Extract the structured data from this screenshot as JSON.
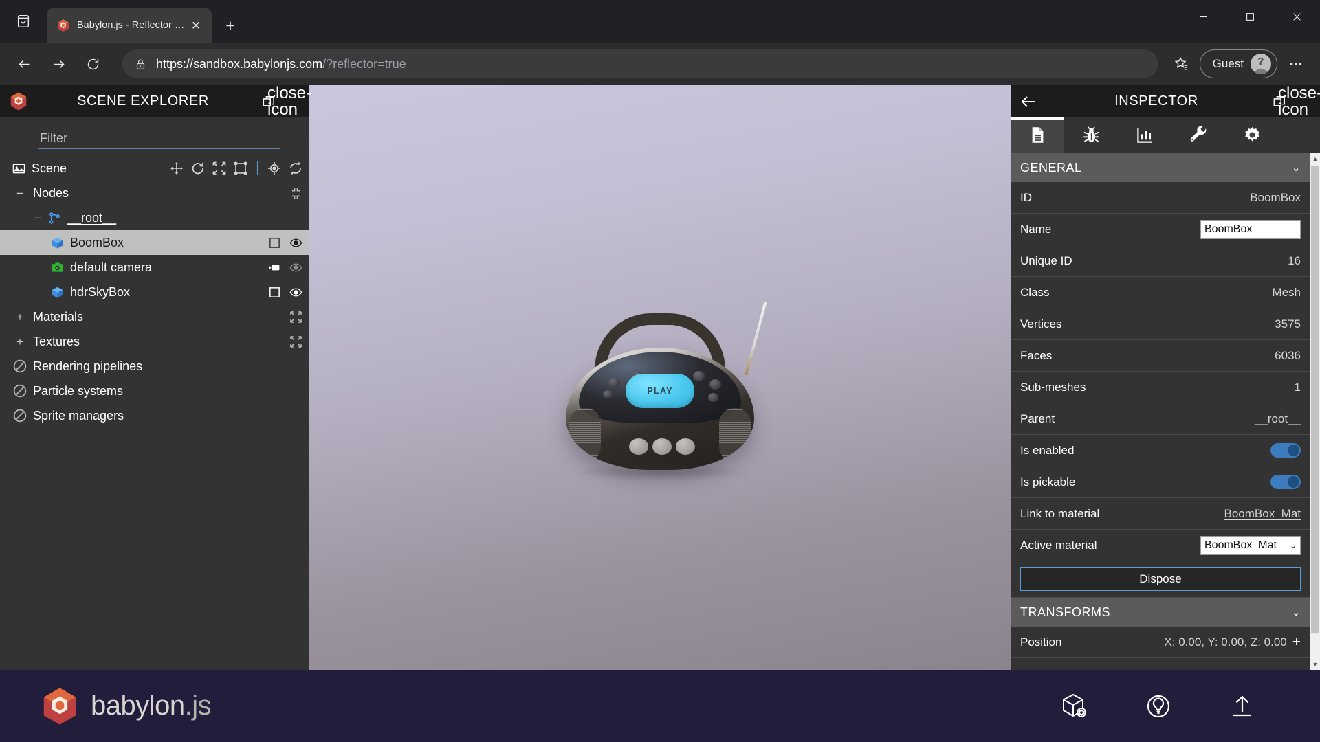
{
  "browser": {
    "tab": {
      "title": "Babylon.js - Reflector scene",
      "favicon": "babylon-logo-icon",
      "close": "✕"
    },
    "new_tab_label": "+",
    "tab_list_icon": "tab-list-icon",
    "nav": {
      "back": "back-arrow-icon",
      "forward": "forward-arrow-icon",
      "reload": "reload-icon"
    },
    "omnibox": {
      "lock": "lock-icon",
      "url_host": "https://sandbox.babylonjs.com",
      "url_path": "/?reflector=true",
      "full_url": "https://sandbox.babylonjs.com/?reflector=true"
    },
    "favorites_icon": "favorites-star-icon",
    "profile": {
      "name": "Guest",
      "avatar_badge": "?"
    },
    "settings_icon": "more-options-icon",
    "window": {
      "minimize": "minimize-icon",
      "maximize": "maximize-icon",
      "close": "close-icon"
    }
  },
  "scene_explorer": {
    "title": "SCENE EXPLORER",
    "logo": "babylon-hex-logo",
    "popout_icon": "popout-window-icon",
    "close_icon": "close-icon",
    "filter": {
      "placeholder": "Filter",
      "value": ""
    },
    "scene_row": {
      "label": "Scene",
      "icon": "scene-image-icon",
      "gizmos": [
        "move-gizmo-icon",
        "rotate-gizmo-icon",
        "scale-gizmo-icon",
        "bounding-box-gizmo-icon"
      ],
      "pivot_icon": "pivot-target-icon",
      "refresh_icon": "refresh-icon"
    },
    "tree": [
      {
        "label": "Nodes",
        "indent": 1,
        "expander": "−",
        "icon": "",
        "actions": [
          "collapse-all-icon"
        ],
        "selected": false
      },
      {
        "label": "__root__",
        "indent": 2,
        "expander": "−",
        "icon": "transform-node-icon",
        "actions": [],
        "selected": false,
        "underlined": true
      },
      {
        "label": "BoomBox",
        "indent": 3,
        "expander": "",
        "icon": "mesh-cube-icon",
        "actions": [
          "checkbox-icon",
          "eye-visible-icon"
        ],
        "selected": true
      },
      {
        "label": "default camera",
        "indent": 3,
        "expander": "",
        "icon": "camera-icon",
        "actions": [
          "video-camera-icon",
          "eye-dim-icon"
        ],
        "selected": false
      },
      {
        "label": "hdrSkyBox",
        "indent": 3,
        "expander": "",
        "icon": "mesh-cube-icon",
        "actions": [
          "checkbox-icon",
          "eye-visible-icon"
        ],
        "selected": false
      },
      {
        "label": "Materials",
        "indent": 1,
        "expander": "+",
        "icon": "",
        "actions": [
          "expand-arrows-icon"
        ],
        "selected": false
      },
      {
        "label": "Textures",
        "indent": 1,
        "expander": "+",
        "icon": "",
        "actions": [
          "expand-arrows-icon"
        ],
        "selected": false
      },
      {
        "label": "Rendering pipelines",
        "indent": 1,
        "expander": "∅",
        "icon": "",
        "actions": [],
        "selected": false
      },
      {
        "label": "Particle systems",
        "indent": 1,
        "expander": "∅",
        "icon": "",
        "actions": [],
        "selected": false
      },
      {
        "label": "Sprite managers",
        "indent": 1,
        "expander": "∅",
        "icon": "",
        "actions": [],
        "selected": false
      }
    ]
  },
  "inspector": {
    "title": "INSPECTOR",
    "back_icon": "back-arrow-icon",
    "popout_icon": "popout-window-icon",
    "close_icon": "close-icon",
    "tabs": [
      {
        "name": "properties",
        "icon": "document-icon",
        "active": true
      },
      {
        "name": "debug",
        "icon": "bug-icon",
        "active": false
      },
      {
        "name": "statistics",
        "icon": "bar-chart-icon",
        "active": false
      },
      {
        "name": "tools",
        "icon": "wrench-icon",
        "active": false
      },
      {
        "name": "settings",
        "icon": "gear-icon",
        "active": false
      }
    ],
    "sections": [
      {
        "title": "GENERAL",
        "collapse_chevron": "⌄",
        "rows": [
          {
            "label": "ID",
            "value": "BoomBox",
            "type": "text"
          },
          {
            "label": "Name",
            "value": "BoomBox",
            "type": "input"
          },
          {
            "label": "Unique ID",
            "value": "16",
            "type": "text"
          },
          {
            "label": "Class",
            "value": "Mesh",
            "type": "text"
          },
          {
            "label": "Vertices",
            "value": "3575",
            "type": "text"
          },
          {
            "label": "Faces",
            "value": "6036",
            "type": "text"
          },
          {
            "label": "Sub-meshes",
            "value": "1",
            "type": "text"
          },
          {
            "label": "Parent",
            "value": "__root__",
            "type": "link"
          },
          {
            "label": "Is enabled",
            "value": "on",
            "type": "toggle"
          },
          {
            "label": "Is pickable",
            "value": "on",
            "type": "toggle"
          },
          {
            "label": "Link to material",
            "value": "BoomBox_Mat",
            "type": "link"
          },
          {
            "label": "Active material",
            "value": "BoomBox_Mat",
            "type": "select"
          }
        ],
        "button": "Dispose"
      },
      {
        "title": "TRANSFORMS",
        "collapse_chevron": "⌄",
        "rows": [
          {
            "label": "Position",
            "value": "X: 0.00, Y: 0.00, Z: 0.00",
            "type": "vector",
            "add_icon": "+"
          }
        ]
      }
    ],
    "scrollbar": {
      "up": "▲",
      "down": "▼"
    }
  },
  "viewport": {
    "model": {
      "name": "BoomBox",
      "screen_text": "PLAY",
      "parts": [
        "antenna",
        "handle",
        "top-panel",
        "display-screen",
        "speaker-left",
        "speaker-right",
        "control-buttons"
      ]
    },
    "background_top": "#c8c7dd",
    "background_bottom": "#8b848d"
  },
  "footer": {
    "brand_name": "babylon",
    "brand_suffix": ".js",
    "logo": "babylon-hex-logo",
    "actions": [
      {
        "name": "inspector-toggle",
        "icon": "cube-gear-icon"
      },
      {
        "name": "environment-lighting",
        "icon": "lightbulb-circle-icon"
      },
      {
        "name": "upload-model",
        "icon": "upload-arrow-icon"
      }
    ]
  },
  "colors": {
    "brand_orange": "#e0683c",
    "brand_red": "#bf4040",
    "footer_bg": "#211d3b",
    "panel_bg": "#333333",
    "panel_header_bg": "#1c1c1c",
    "accent_blue": "#5b9bd5",
    "toggle_on": "#3d7dbf",
    "selected_row": "#c0c0c0"
  }
}
